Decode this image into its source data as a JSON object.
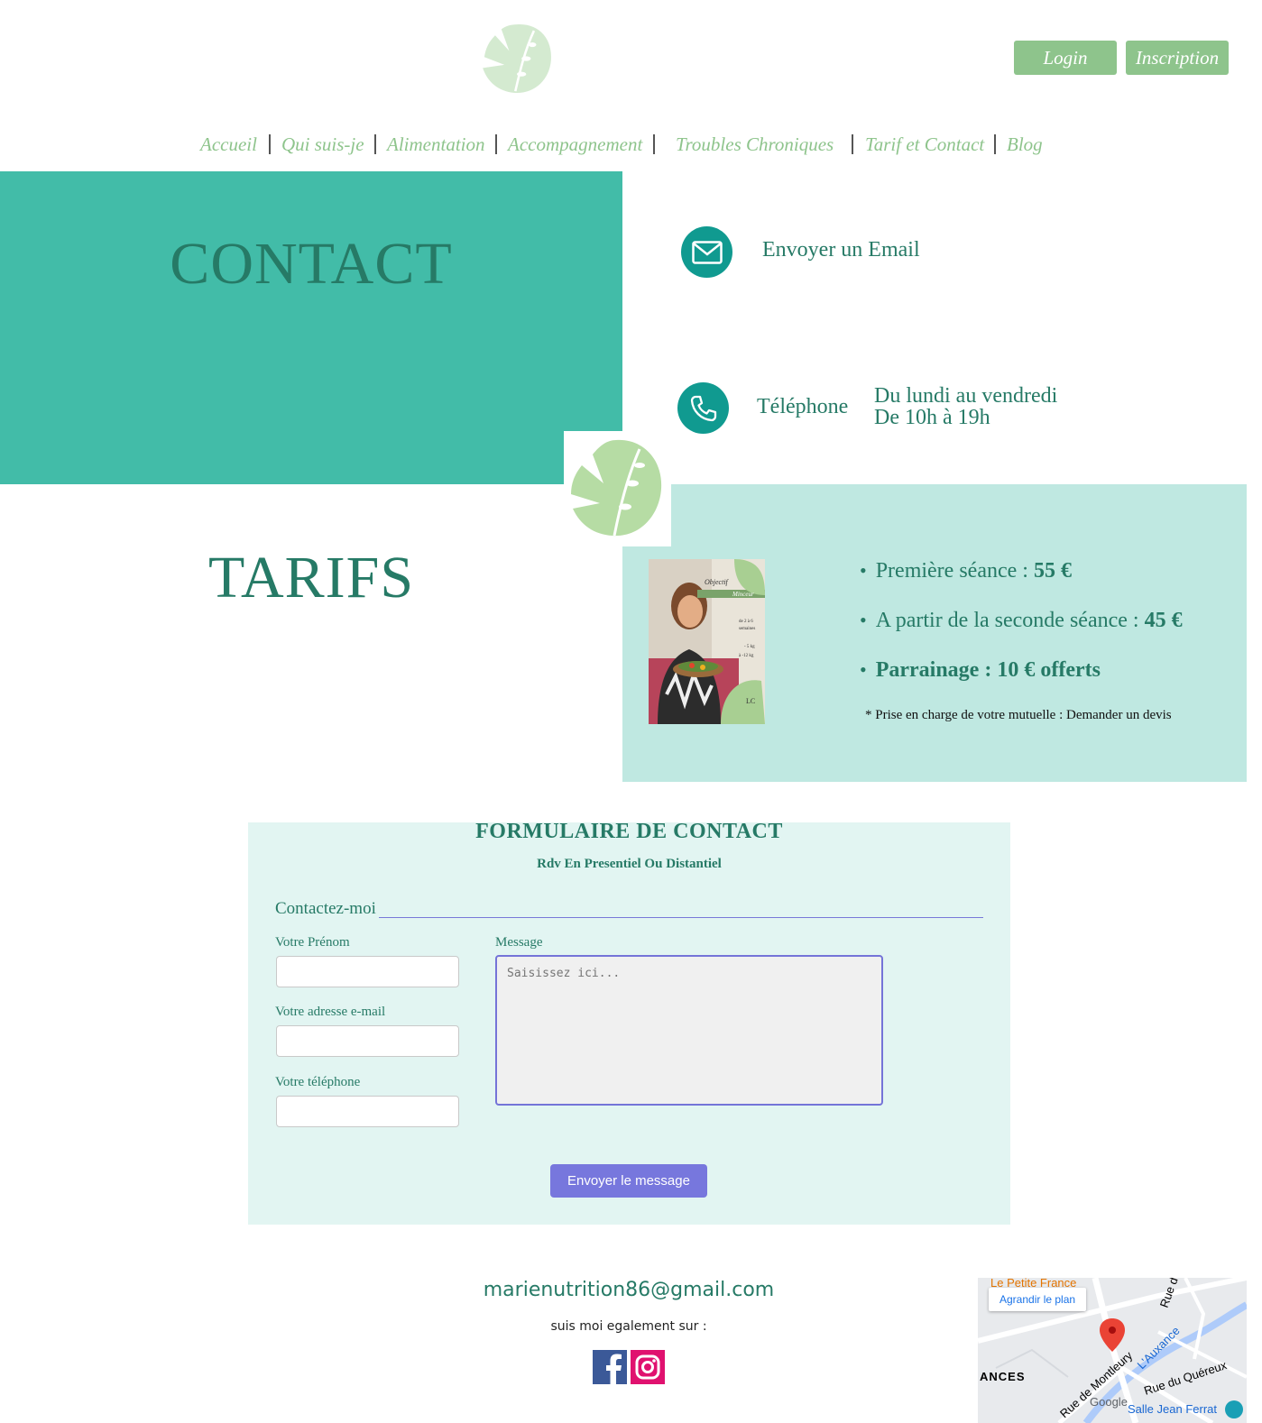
{
  "header": {
    "login_label": "Login",
    "inscription_label": "Inscription"
  },
  "nav": {
    "items": [
      "Accueil",
      "Qui suis-je",
      "Alimentation",
      "Accompagnement",
      "Troubles Chroniques",
      "Tarif et Contact",
      "Blog"
    ]
  },
  "contact": {
    "title": "CONTACT",
    "email_label": "Envoyer un Email",
    "phone_label": "Téléphone",
    "hours_line1": "Du lundi au vendredi",
    "hours_line2": "De 10h à 19h"
  },
  "tarifs": {
    "title": "TARIFS",
    "items": [
      {
        "label": "Première séance : ",
        "value": "55 €"
      },
      {
        "label": "A partir de la seconde séance : ",
        "value": "45 €"
      },
      {
        "label": "",
        "value": "Parrainage : 10 € offerts"
      }
    ],
    "note": "* Prise en charge de votre mutuelle : Demander un devis",
    "book_lines": [
      "Objectif",
      "Minceur",
      "de 2 à 6",
      "semaines",
      "- 5 kg",
      "à -12 kg",
      "LC"
    ]
  },
  "form": {
    "title": "FORMULAIRE DE CONTACT",
    "subtitle": "Rdv En Presentiel Ou Distantiel",
    "legend": "Contactez-moi",
    "prenom_label": "Votre Prénom",
    "email_label": "Votre adresse e-mail",
    "phone_label": "Votre téléphone",
    "message_label": "Message",
    "message_placeholder": "Saisissez ici...",
    "submit_label": "Envoyer le message"
  },
  "footer": {
    "email": "marienutrition86@gmail.com",
    "follow_text": "suis moi egalement sur :"
  },
  "map": {
    "enlarge_label": "Agrandir le plan",
    "labels": [
      "Le Petite France",
      "ANCES",
      "L'Auxance",
      "Rue du Quéreux",
      "Rue de Montleury",
      "Salle Jean Ferrat",
      "Rue de S"
    ],
    "google": "Google"
  },
  "colors": {
    "accent_green": "#8ec48c",
    "teal_dark": "#267a66",
    "teal_block": "#42bca8",
    "mint_block": "#bfe8e1",
    "form_bg": "#e2f5f2",
    "button_violet": "#7777dd"
  },
  "icons": [
    "monstera-logo-icon",
    "email-icon",
    "phone-icon",
    "facebook-icon",
    "instagram-icon",
    "map-pin-icon"
  ]
}
